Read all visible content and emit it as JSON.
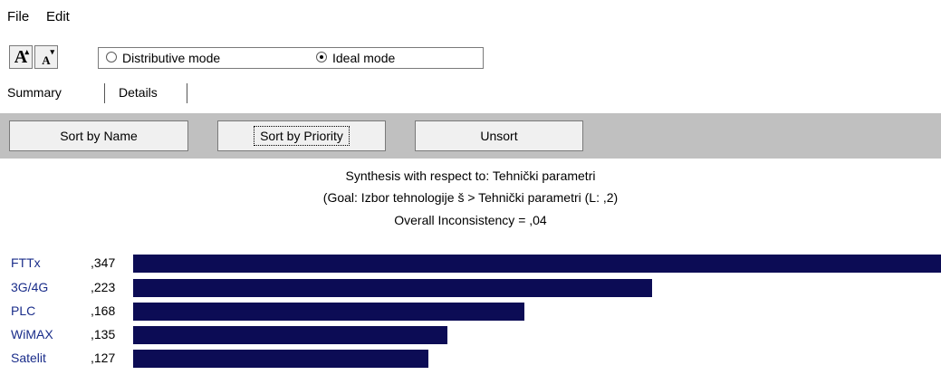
{
  "menu": {
    "file": "File",
    "edit": "Edit"
  },
  "font_buttons": {
    "increase": "A",
    "decrease": "A"
  },
  "modes": {
    "distributive": "Distributive mode",
    "ideal": "Ideal mode",
    "selected": "ideal"
  },
  "tabs": [
    "Summary",
    "Details"
  ],
  "sort_buttons": {
    "by_name": "Sort by Name",
    "by_priority": "Sort by Priority",
    "unsort": "Unsort"
  },
  "synthesis": {
    "line1": "Synthesis with respect to: Tehnički parametri",
    "line2": "(Goal: Izbor tehnologije š > Tehnički parametri (L: ,2)",
    "line3": "Overall Inconsistency = ,04"
  },
  "colors": {
    "bar": "#0c0c55",
    "label": "#1a2d8a",
    "sortbar": "#c0c0c0"
  },
  "rows": [
    {
      "name": "FTTx",
      "value": ",347",
      "num": 0.347
    },
    {
      "name": "3G/4G",
      "value": ",223",
      "num": 0.223
    },
    {
      "name": "PLC",
      "value": ",168",
      "num": 0.168
    },
    {
      "name": "WiMAX",
      "value": ",135",
      "num": 0.135
    },
    {
      "name": "Satelit",
      "value": ",127",
      "num": 0.127
    }
  ]
}
